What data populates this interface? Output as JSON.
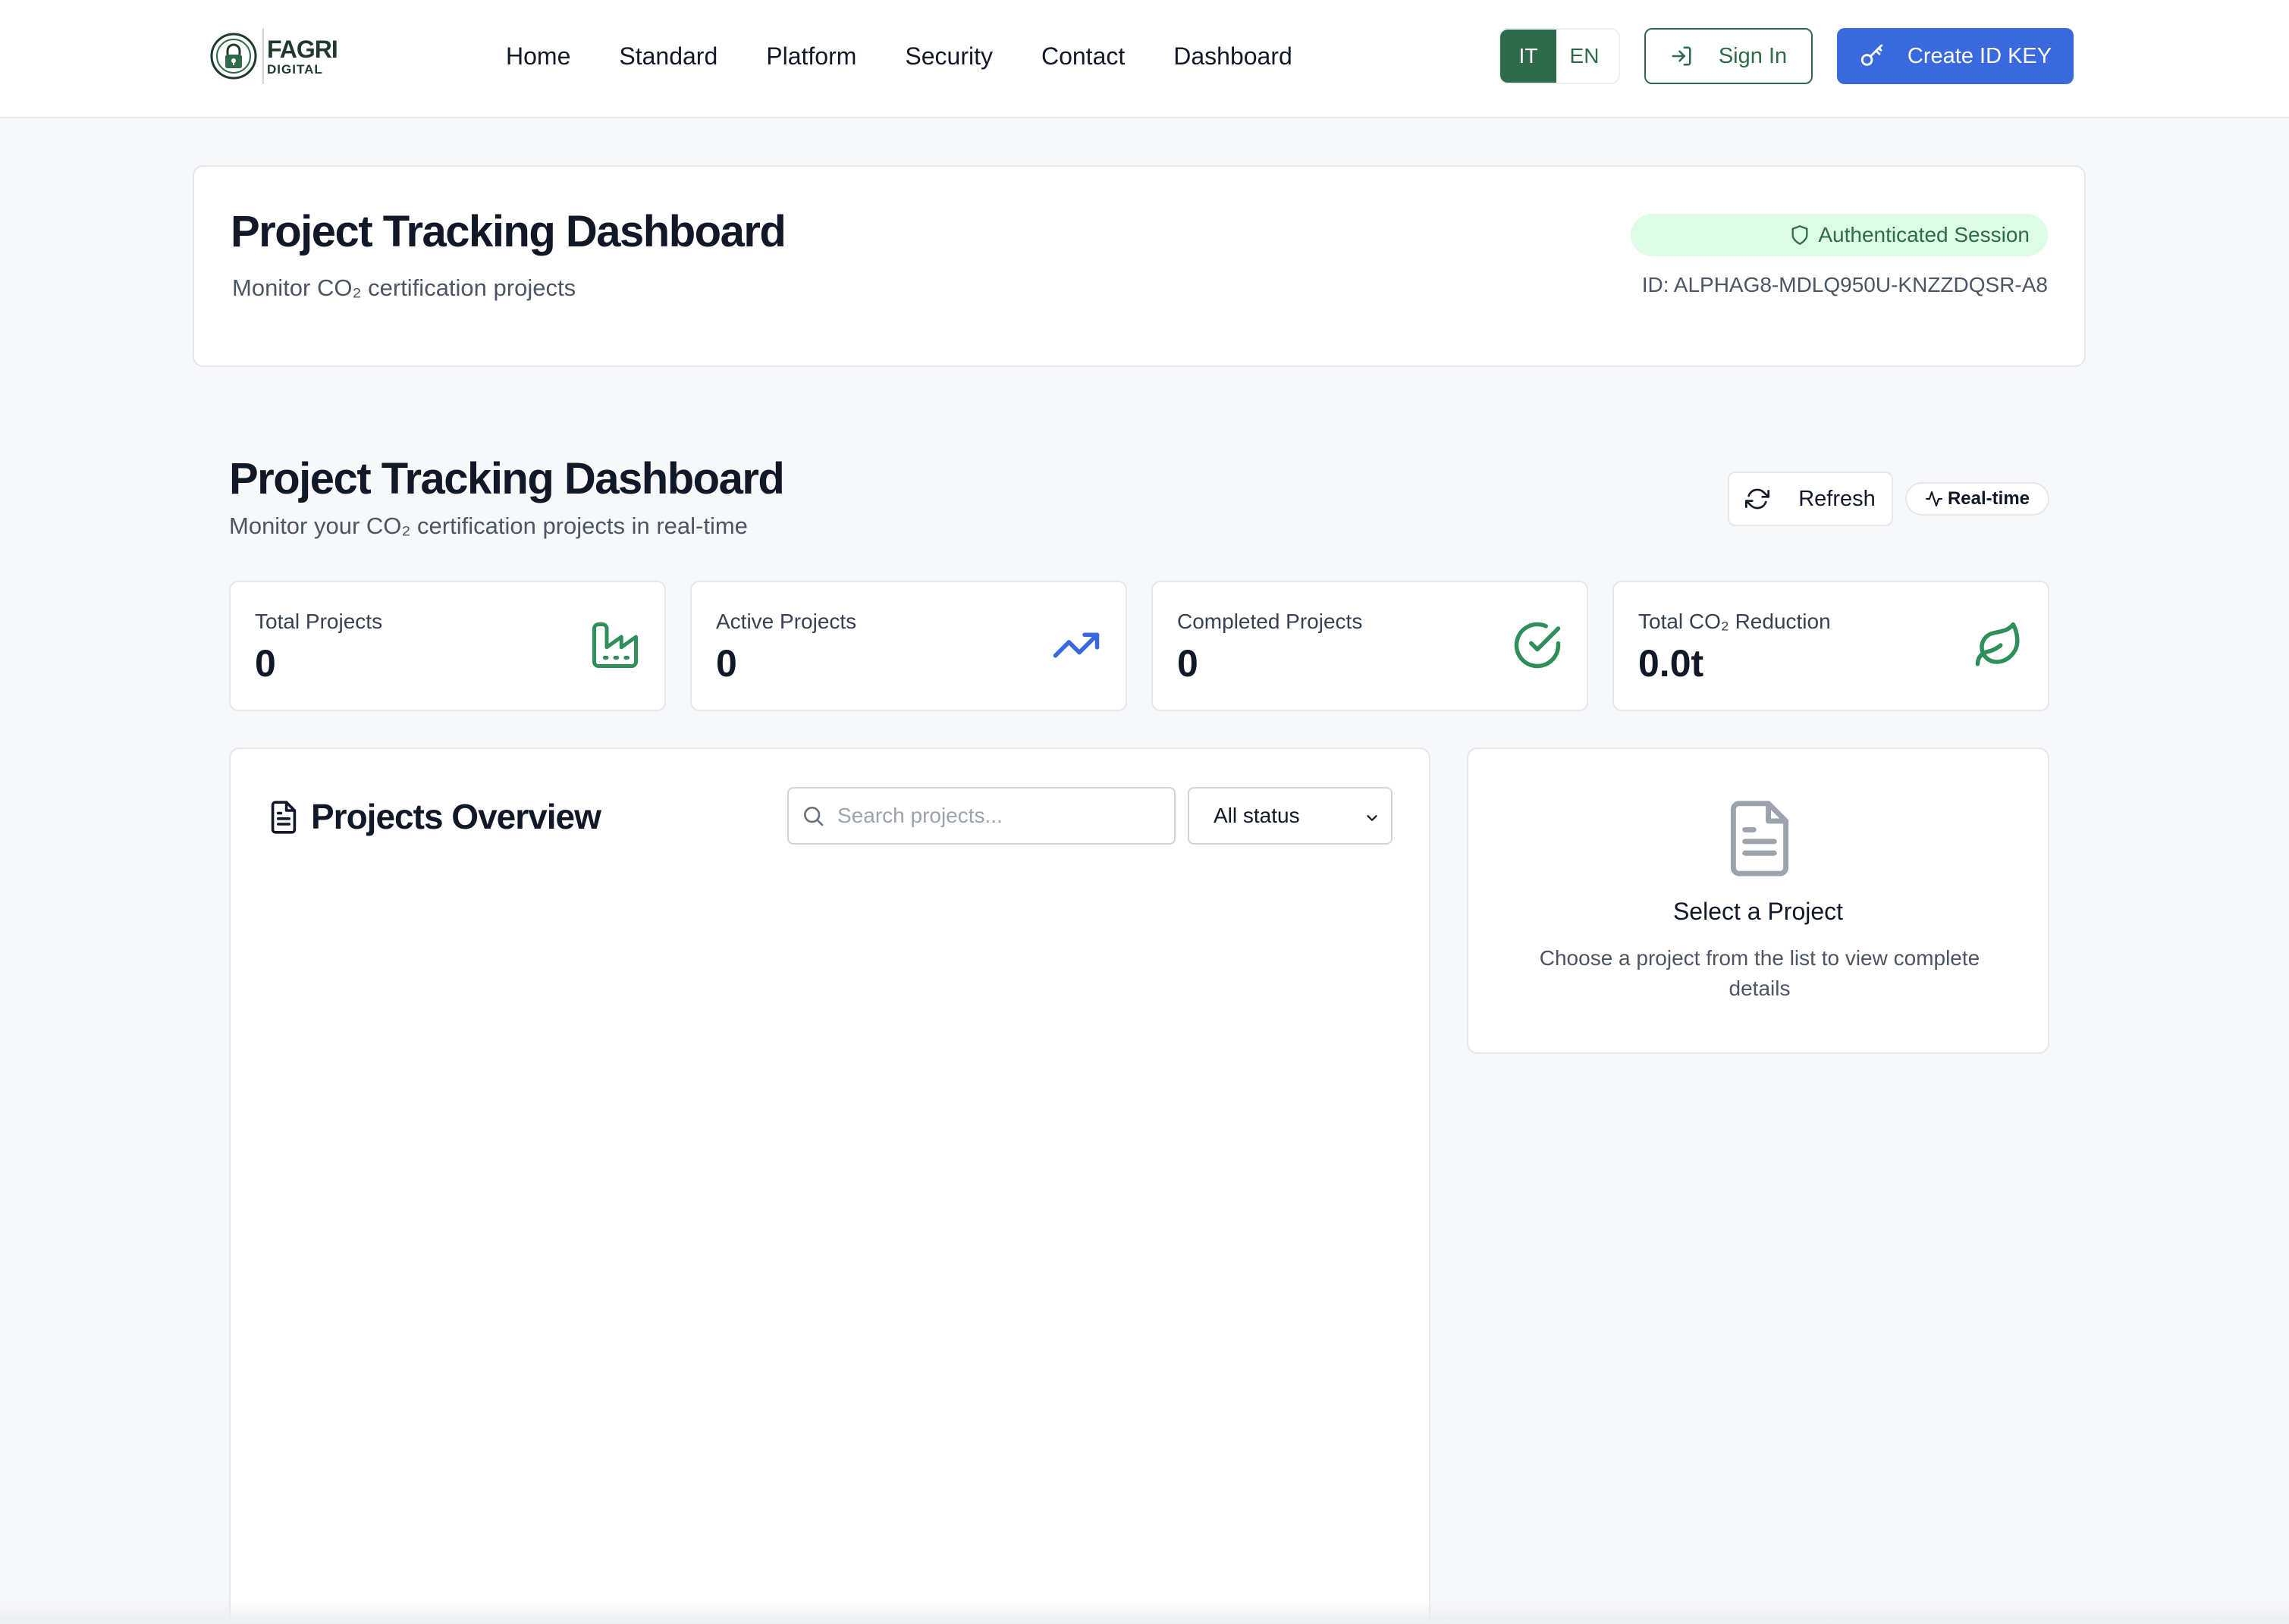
{
  "brand": {
    "name_line1": "FAGRI",
    "name_line2": "DIGITAL"
  },
  "nav": {
    "items": [
      "Home",
      "Standard",
      "Platform",
      "Security",
      "Contact",
      "Dashboard"
    ]
  },
  "language": {
    "options": [
      "IT",
      "EN"
    ],
    "selected": "IT"
  },
  "auth_buttons": {
    "sign_in": "Sign In",
    "create_key": "Create ID KEY"
  },
  "top_card": {
    "title": "Project Tracking Dashboard",
    "subtitle": "Monitor CO₂ certification projects",
    "badge": "Authenticated Session",
    "session_id": "ID: ALPHAG8-MDLQ950U-KNZZDQSR-A8"
  },
  "section": {
    "title": "Project Tracking Dashboard",
    "subtitle": "Monitor your CO₂ certification projects in real-time",
    "refresh_label": "Refresh",
    "realtime_label": "Real-time"
  },
  "stats": [
    {
      "label": "Total Projects",
      "value": "0",
      "icon": "factory-icon",
      "color": "#2f8f5b"
    },
    {
      "label": "Active Projects",
      "value": "0",
      "icon": "trending-up-icon",
      "color": "#3a69dd"
    },
    {
      "label": "Completed Projects",
      "value": "0",
      "icon": "check-circle-icon",
      "color": "#2f8f5b"
    },
    {
      "label": "Total CO₂ Reduction",
      "value": "0.0t",
      "icon": "leaf-icon",
      "color": "#2f8f5b"
    }
  ],
  "overview": {
    "title": "Projects Overview",
    "search_placeholder": "Search projects...",
    "search_value": "",
    "status_filter": "All status"
  },
  "detail_panel": {
    "title": "Select a Project",
    "description": "Choose a project from the list to view complete details"
  },
  "colors": {
    "primary_green": "#2f6b4a",
    "accent_blue": "#3a69dd",
    "badge_bg": "#dcfce7"
  }
}
